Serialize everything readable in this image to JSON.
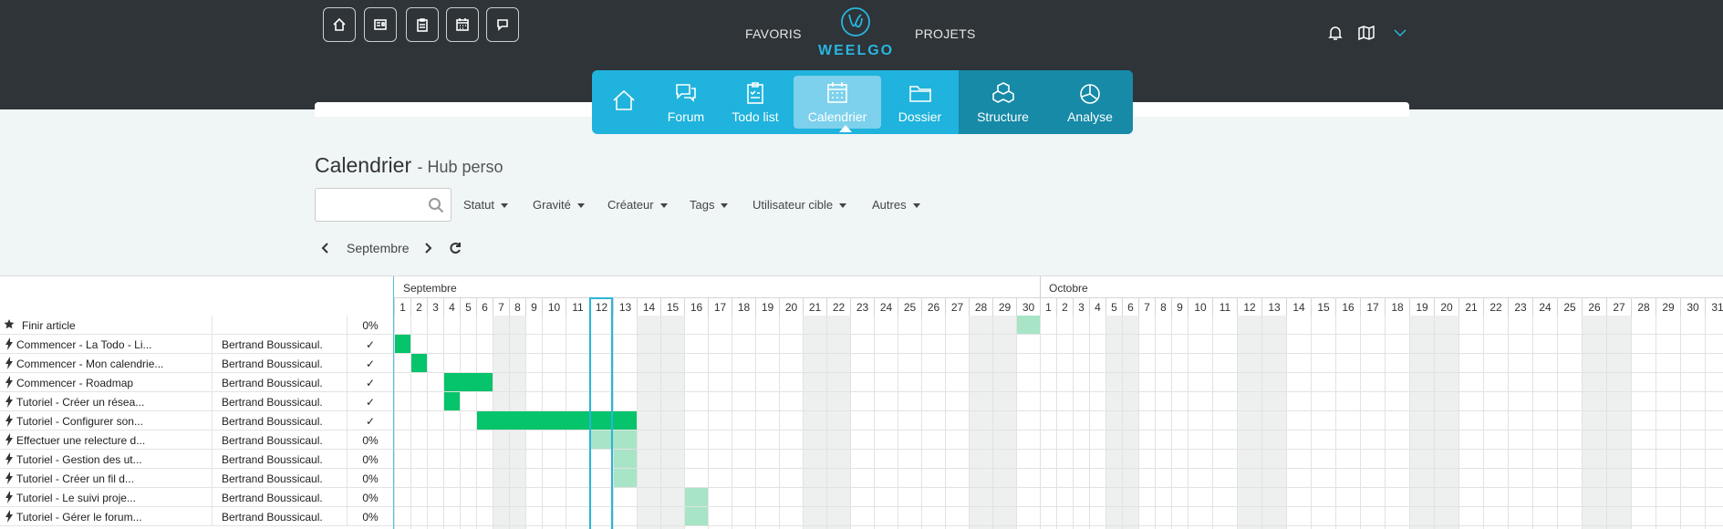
{
  "quick_buttons": [
    {
      "icon": "home-icon"
    },
    {
      "icon": "news-icon"
    },
    {
      "icon": "clipboard-icon"
    },
    {
      "icon": "calendar-icon"
    },
    {
      "icon": "chat-icon"
    }
  ],
  "header": {
    "favoris": "FAVORIS",
    "projets": "PROJETS",
    "logo_text": "WEELGO"
  },
  "header_right": [
    {
      "icon": "bell-icon"
    },
    {
      "icon": "map-icon"
    },
    {
      "icon": "chevron-down-icon"
    }
  ],
  "modules": [
    {
      "label": "",
      "icon": "home-icon"
    },
    {
      "label": "Forum",
      "icon": "chat-bubbles-icon"
    },
    {
      "label": "Todo list",
      "icon": "clipboard-check-icon"
    },
    {
      "label": "Calendrier",
      "icon": "calendar-icon",
      "active": true
    },
    {
      "label": "Dossier",
      "icon": "folder-icon"
    },
    {
      "label": "Structure",
      "icon": "cubes-icon"
    },
    {
      "label": "Analyse",
      "icon": "pie-chart-icon"
    }
  ],
  "page": {
    "title": "Calendrier",
    "subtitle": "- Hub perso"
  },
  "search": {
    "placeholder": "",
    "value": ""
  },
  "filters": [
    "Statut",
    "Gravité",
    "Créateur",
    "Tags",
    "Utilisateur cible",
    "Autres"
  ],
  "month_nav": {
    "label": "Septembre"
  },
  "calendar": {
    "months": [
      {
        "name": "Septembre",
        "days": 30,
        "weekends": [
          7,
          8,
          14,
          15,
          21,
          22,
          28,
          29
        ]
      },
      {
        "name": "Octobre",
        "days": 31,
        "weekends": [
          5,
          6,
          12,
          13,
          19,
          20,
          26,
          27
        ]
      }
    ],
    "today": 12
  },
  "tasks": [
    {
      "title": "Finir article",
      "assignee": "",
      "progress": "0%",
      "icon": "star-icon",
      "bars": [
        {
          "start": 30,
          "end": 30,
          "kind": "plan"
        }
      ]
    },
    {
      "title": "Commencer - La Todo - Li...",
      "assignee": "Bertrand Boussicaul.",
      "progress": "✓",
      "icon": "bolt-icon",
      "bars": [
        {
          "start": 1,
          "end": 1,
          "kind": "done"
        }
      ]
    },
    {
      "title": "Commencer - Mon calendrie...",
      "assignee": "Bertrand Boussicaul.",
      "progress": "✓",
      "icon": "bolt-icon",
      "bars": [
        {
          "start": 2,
          "end": 2,
          "kind": "done"
        }
      ]
    },
    {
      "title": "Commencer - Roadmap",
      "assignee": "Bertrand Boussicaul.",
      "progress": "✓",
      "icon": "bolt-icon",
      "bars": [
        {
          "start": 4,
          "end": 6,
          "kind": "done"
        }
      ]
    },
    {
      "title": "Tutoriel - Créer un résea...",
      "assignee": "Bertrand Boussicaul.",
      "progress": "✓",
      "icon": "bolt-icon",
      "bars": [
        {
          "start": 4,
          "end": 4,
          "kind": "done"
        }
      ]
    },
    {
      "title": "Tutoriel - Configurer son...",
      "assignee": "Bertrand Boussicaul.",
      "progress": "✓",
      "icon": "bolt-icon",
      "bars": [
        {
          "start": 6,
          "end": 13,
          "kind": "done"
        }
      ]
    },
    {
      "title": "Effectuer une relecture d...",
      "assignee": "Bertrand Boussicaul.",
      "progress": "0%",
      "icon": "bolt-icon",
      "bars": [
        {
          "start": 12,
          "end": 13,
          "kind": "plan"
        }
      ]
    },
    {
      "title": "Tutoriel - Gestion des ut...",
      "assignee": "Bertrand Boussicaul.",
      "progress": "0%",
      "icon": "bolt-icon",
      "bars": [
        {
          "start": 13,
          "end": 13,
          "kind": "plan"
        }
      ]
    },
    {
      "title": "Tutoriel - Créer un fil d...",
      "assignee": "Bertrand Boussicaul.",
      "progress": "0%",
      "icon": "bolt-icon",
      "bars": [
        {
          "start": 13,
          "end": 13,
          "kind": "plan"
        }
      ]
    },
    {
      "title": "Tutoriel - Le suivi proje...",
      "assignee": "Bertrand Boussicaul.",
      "progress": "0%",
      "icon": "bolt-icon",
      "bars": [
        {
          "start": 16,
          "end": 16,
          "kind": "plan"
        }
      ]
    },
    {
      "title": "Tutoriel - Gérer le forum...",
      "assignee": "Bertrand Boussicaul.",
      "progress": "0%",
      "icon": "bolt-icon",
      "bars": [
        {
          "start": 16,
          "end": 16,
          "kind": "plan"
        }
      ]
    }
  ],
  "colors": {
    "accent": "#1fb3dd",
    "done": "#05c46b",
    "planned": "#a8e4c6",
    "header_bg": "#2e3438"
  }
}
